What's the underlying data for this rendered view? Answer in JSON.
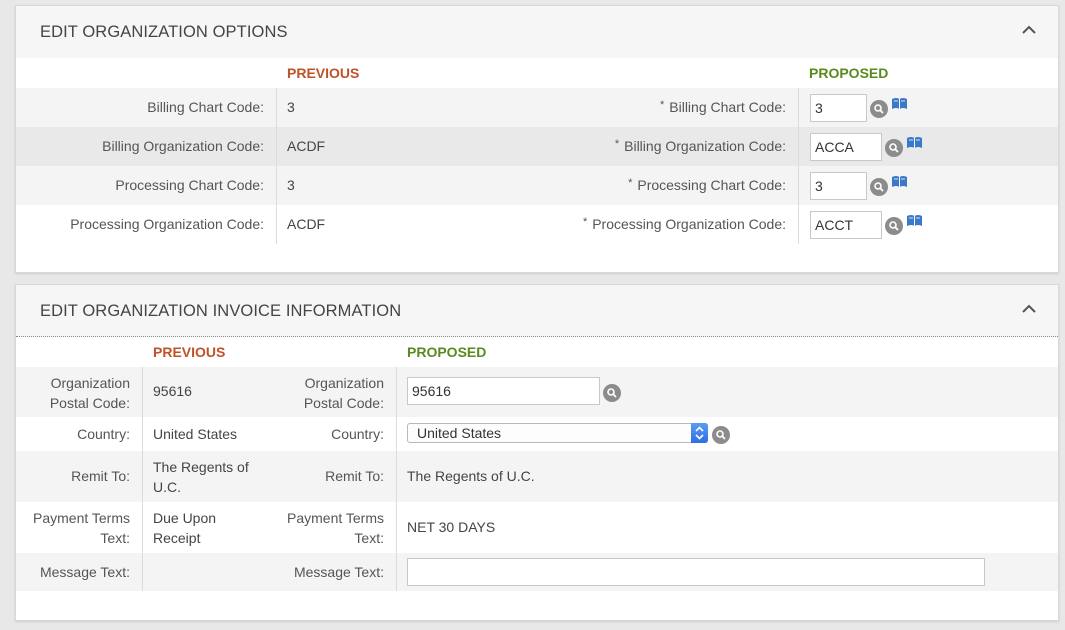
{
  "options_panel": {
    "title": "EDIT ORGANIZATION OPTIONS",
    "previous_header": "PREVIOUS",
    "proposed_header": "PROPOSED",
    "rows": [
      {
        "label": "Billing Chart Code:",
        "previous": "3",
        "proposed_label": "Billing Chart Code:",
        "proposed": "3"
      },
      {
        "label": "Billing Organization Code:",
        "previous": "ACDF",
        "proposed_label": "Billing Organization Code:",
        "proposed": "ACCA"
      },
      {
        "label": "Processing Chart Code:",
        "previous": "3",
        "proposed_label": "Processing Chart Code:",
        "proposed": "3"
      },
      {
        "label": "Processing Organization Code:",
        "previous": "ACDF",
        "proposed_label": "Processing Organization Code:",
        "proposed": "ACCT"
      }
    ],
    "required_mark": "*"
  },
  "invoice_panel": {
    "title": "EDIT ORGANIZATION INVOICE INFORMATION",
    "previous_header": "PREVIOUS",
    "proposed_header": "PROPOSED",
    "postal": {
      "label_1": "Organization",
      "label_2": "Postal Code:",
      "previous": "95616",
      "proposed": "95616"
    },
    "country": {
      "label": "Country:",
      "previous": "United States",
      "proposed": "United States"
    },
    "remit": {
      "label": "Remit To:",
      "previous_1": "The Regents of",
      "previous_2": "U.C.",
      "proposed": "The Regents of U.C."
    },
    "payment": {
      "label_1": "Payment Terms",
      "label_2": "Text:",
      "previous_1": "Due Upon",
      "previous_2": "Receipt",
      "proposed": "NET 30 DAYS"
    },
    "message": {
      "label": "Message Text:",
      "previous": "",
      "proposed": ""
    }
  },
  "colors": {
    "previous": "#c0522a",
    "proposed": "#5a8a1e",
    "accent": "#2d6fe0"
  },
  "icons": [
    "chevron-up-icon",
    "search-icon",
    "book-icon",
    "select-arrows-icon"
  ]
}
